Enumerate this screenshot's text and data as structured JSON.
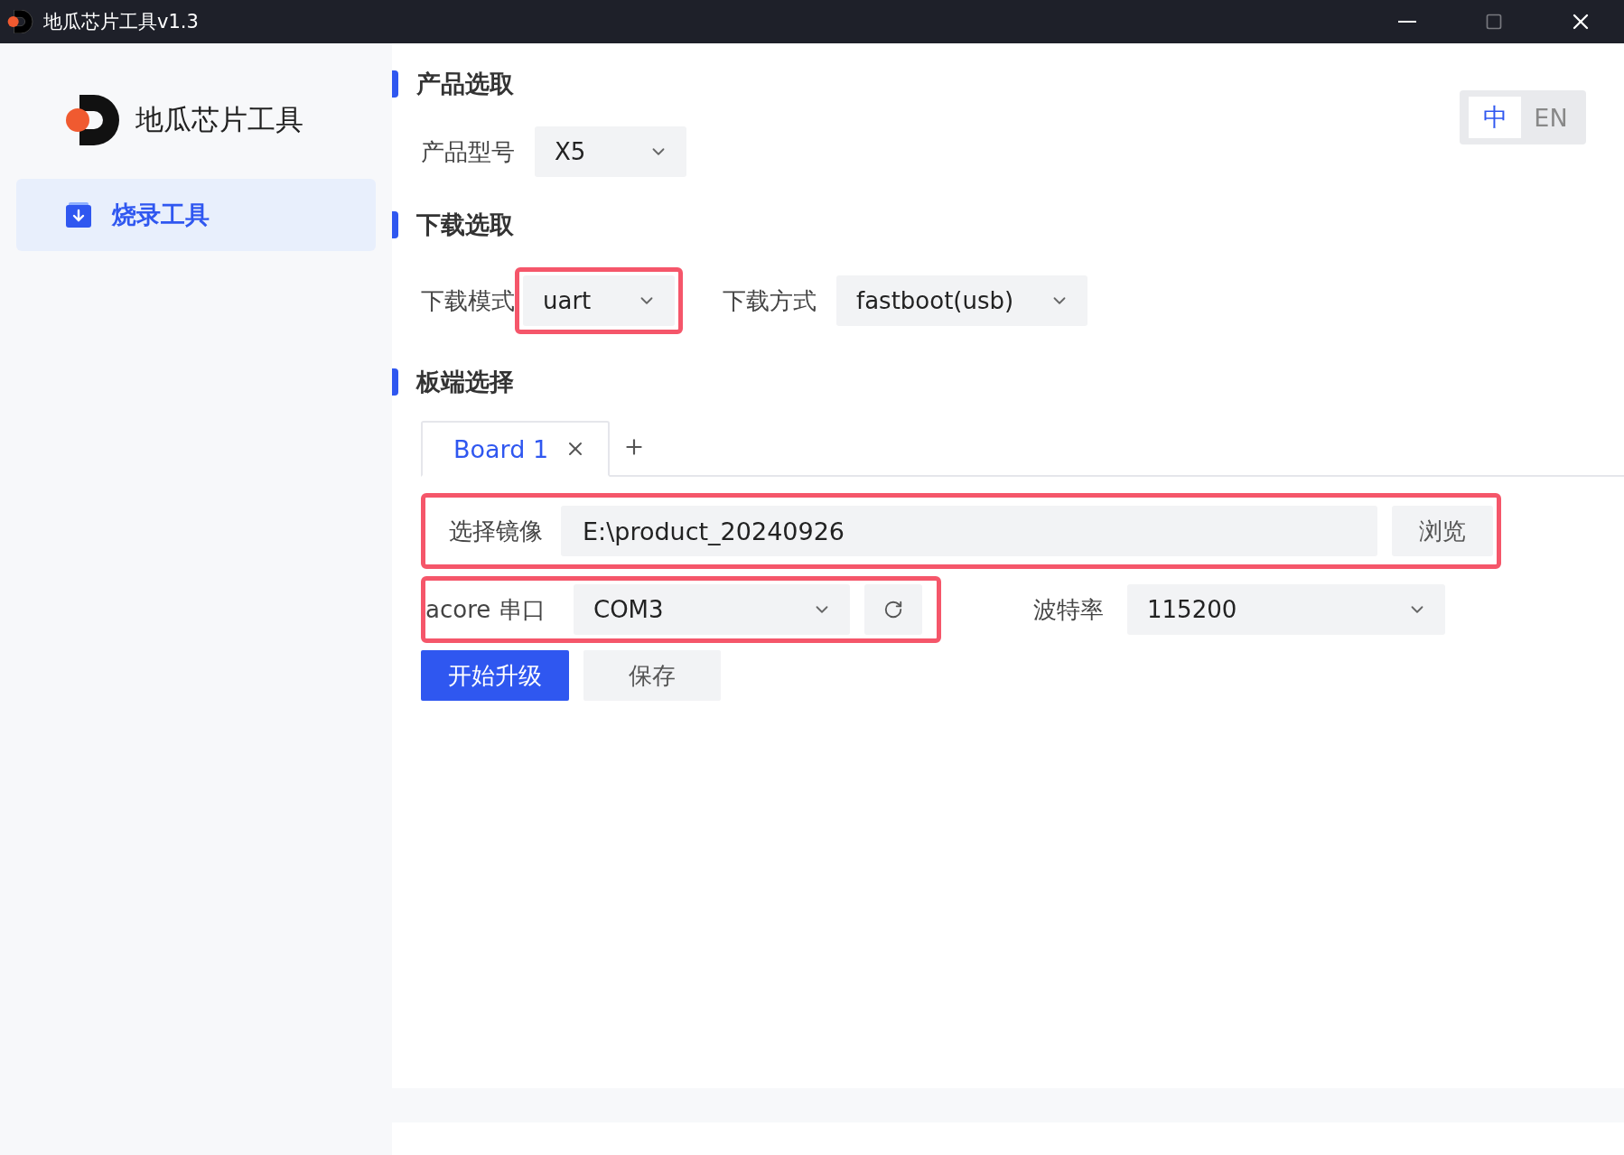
{
  "window": {
    "title": "地瓜芯片工具v1.3"
  },
  "sidebar": {
    "brand": "地瓜芯片工具",
    "items": [
      {
        "label": "烧录工具",
        "selected": true
      }
    ]
  },
  "language_toggle": [
    {
      "label": "中",
      "selected": true
    },
    {
      "label": "EN",
      "selected": false
    }
  ],
  "sections": [
    {
      "title": "产品选取",
      "fields": [
        {
          "label": "产品型号",
          "value": "X5"
        }
      ]
    },
    {
      "title": "下载选取",
      "fields": [
        {
          "label": "下载模式",
          "value": "uart",
          "highlighted": true
        },
        {
          "label": "下载方式",
          "value": "fastboot(usb)"
        }
      ]
    },
    {
      "title": "板端选择"
    }
  ],
  "board_tabs": [
    {
      "label": "Board 1",
      "selected": true
    }
  ],
  "board_form": {
    "image": {
      "label": "选择镜像",
      "value": "E:\\product_20240926",
      "button": "浏览",
      "highlighted": true
    },
    "serial": {
      "label": "acore 串口",
      "value": "COM3",
      "highlighted": true
    },
    "baud": {
      "label": "波特率",
      "value": "115200"
    },
    "actions": [
      {
        "label": "开始升级",
        "kind": "primary"
      },
      {
        "label": "保存",
        "kind": "secondary"
      }
    ]
  }
}
